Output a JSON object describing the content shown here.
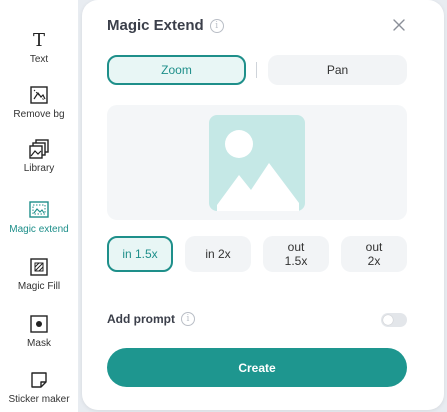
{
  "rail": {
    "items": [
      {
        "label": "Text",
        "icon": "text-icon"
      },
      {
        "label": "Remove bg",
        "icon": "remove-bg-icon"
      },
      {
        "label": "Library",
        "icon": "library-icon"
      },
      {
        "label": "Magic extend",
        "icon": "magic-extend-icon",
        "active": true
      },
      {
        "label": "Magic Fill",
        "icon": "magic-fill-icon"
      },
      {
        "label": "Mask",
        "icon": "mask-icon"
      },
      {
        "label": "Sticker maker",
        "icon": "sticker-maker-icon"
      }
    ]
  },
  "panel": {
    "title": "Magic Extend",
    "mode_tabs": {
      "zoom": "Zoom",
      "pan": "Pan",
      "selected": "Zoom"
    },
    "zoom_options": [
      {
        "line1": "in 1.5x",
        "line2": ""
      },
      {
        "line1": "in 2x",
        "line2": ""
      },
      {
        "line1": "out",
        "line2": "1.5x"
      },
      {
        "line1": "out",
        "line2": "2x"
      }
    ],
    "selected_zoom_option": "in 1.5x",
    "add_prompt_label": "Add prompt",
    "add_prompt_enabled": false,
    "create_label": "Create"
  },
  "colors": {
    "accent": "#1e8f8a",
    "create_button": "#1e968f",
    "preview_placeholder": "#c5e8e6"
  }
}
